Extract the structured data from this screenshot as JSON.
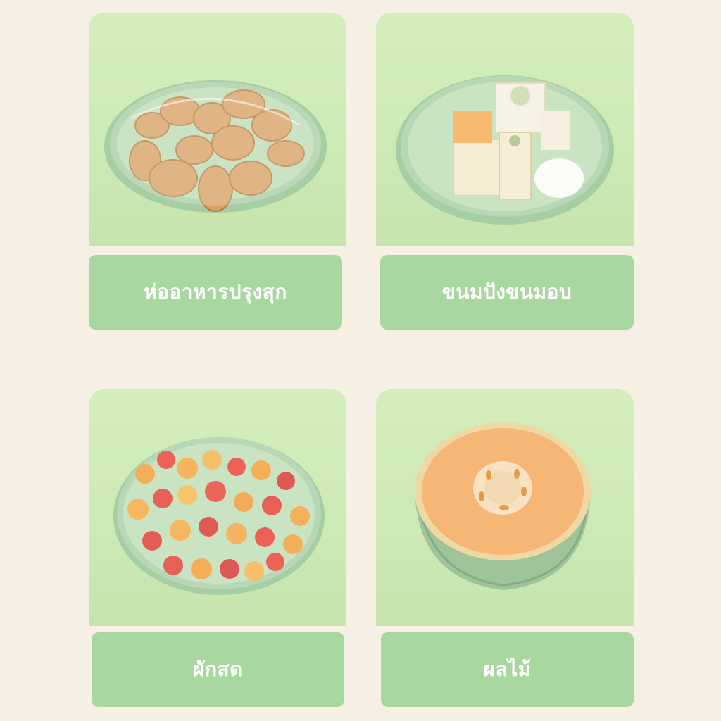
{
  "cards": [
    {
      "label": "ห่ออาหารปรุงสุก",
      "icon": "fried-chicken-plate-icon"
    },
    {
      "label": "ขนมปังขนมอบ",
      "icon": "cake-plate-icon"
    },
    {
      "label": "ผักสด",
      "icon": "tomato-plate-icon"
    },
    {
      "label": "ผลไม้",
      "icon": "melon-icon"
    }
  ],
  "colors": {
    "background": "#f6f0e4",
    "panel": "#cde9b4",
    "label_bg": "#a8d7a0",
    "label_text": "#ffffff",
    "plate": "#a9cfa5"
  }
}
